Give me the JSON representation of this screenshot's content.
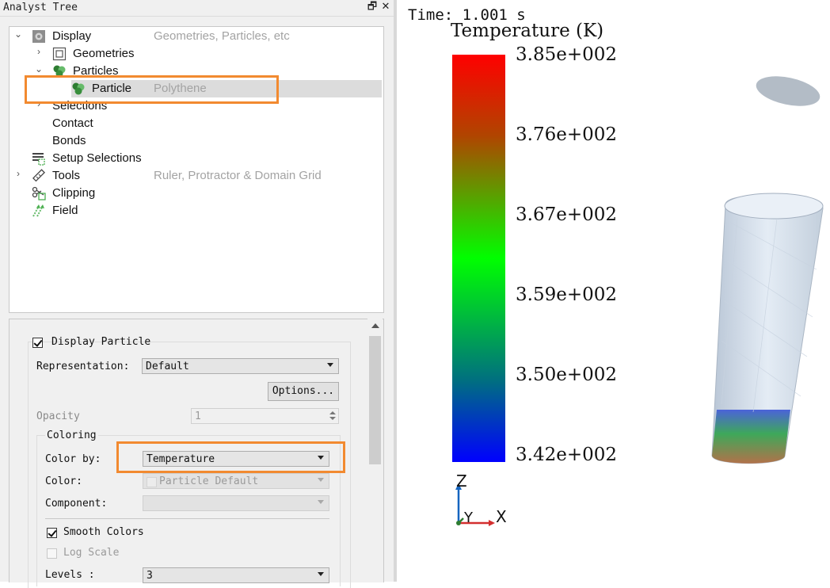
{
  "panel": {
    "title": "Analyst Tree",
    "float_glyph": "🗗",
    "close_glyph": "✕"
  },
  "tree": {
    "items": [
      {
        "label": "Display",
        "description": "Geometries, Particles, etc",
        "icon": "gear-icon",
        "arrow": "⌄"
      },
      {
        "label": "Geometries",
        "description": "",
        "icon": "geometry-box-icon",
        "arrow": "›"
      },
      {
        "label": "Particles",
        "description": "",
        "icon": "particles-icon",
        "arrow": "⌄"
      },
      {
        "label": "Particle",
        "description": "Polythene",
        "icon": "particles-icon",
        "arrow": ""
      },
      {
        "label": "Selections",
        "description": "",
        "icon": "",
        "arrow": "›"
      },
      {
        "label": "Contact",
        "description": "",
        "icon": "",
        "arrow": ""
      },
      {
        "label": "Bonds",
        "description": "",
        "icon": "",
        "arrow": ""
      },
      {
        "label": "Setup Selections",
        "description": "",
        "icon": "setup-selections-icon",
        "arrow": ""
      },
      {
        "label": "Tools",
        "description": "Ruler, Protractor & Domain Grid",
        "icon": "ruler-icon",
        "arrow": "›"
      },
      {
        "label": "Clipping",
        "description": "",
        "icon": "scissors-icon",
        "arrow": ""
      },
      {
        "label": "Field",
        "description": "",
        "icon": "field-arrows-icon",
        "arrow": ""
      }
    ]
  },
  "props": {
    "display_particle_label": "Display Particle",
    "display_particle_checked": true,
    "representation_label": "Representation:",
    "representation_value": "Default",
    "options_button": "Options...",
    "opacity_label": "Opacity",
    "opacity_value": "1",
    "coloring_title": "Coloring",
    "color_by_label": "Color by:",
    "color_by_value": "Temperature",
    "color_label": "Color:",
    "color_value": "Particle Default",
    "component_label": "Component:",
    "component_value": "",
    "smooth_colors_label": "Smooth Colors",
    "smooth_colors_checked": true,
    "log_scale_label": "Log Scale",
    "log_scale_checked": false,
    "levels_label": "Levels :",
    "levels_value": "3"
  },
  "viewport": {
    "time_text": "Time: 1.001 s",
    "legend_title": "Temperature (K)",
    "legend_ticks": [
      "3.85e+002",
      "3.76e+002",
      "3.67e+002",
      "3.59e+002",
      "3.50e+002",
      "3.42e+002"
    ],
    "axis_z": "Z",
    "axis_x": "X",
    "axis_y": "Y"
  },
  "colors": {
    "highlight": "#f28a30",
    "legend_top": "#ff0000",
    "legend_mid": "#00ff00",
    "legend_bottom": "#0000ff",
    "geometry": "#d8e1ec"
  }
}
